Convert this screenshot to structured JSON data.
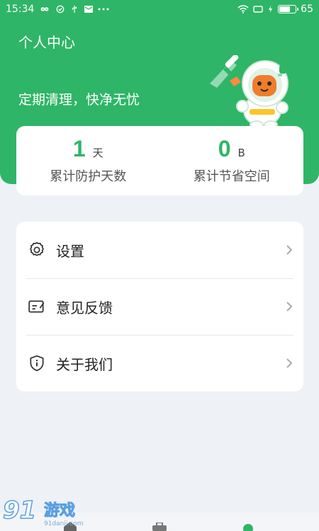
{
  "status_bar": {
    "time": "15:34",
    "battery": "65",
    "icons": [
      "infinity-icon",
      "check-circle-icon",
      "usb-icon",
      "mail-icon",
      "more-icon",
      "wifi-icon",
      "screen-icon",
      "charging-icon",
      "battery-icon"
    ]
  },
  "header": {
    "title": "个人中心",
    "tagline": "定期清理，快净无忧",
    "accent_color": "#2fb567"
  },
  "stats": [
    {
      "value": "1",
      "unit": "天",
      "label": "累计防护天数"
    },
    {
      "value": "0",
      "unit": "B",
      "label": "累计节省空间"
    }
  ],
  "menu": [
    {
      "label": "设置",
      "icon": "gear-icon"
    },
    {
      "label": "意见反馈",
      "icon": "feedback-icon"
    },
    {
      "label": "关于我们",
      "icon": "shield-info-icon"
    }
  ],
  "watermark": {
    "brand": "游戏",
    "site": "91danji.com"
  }
}
